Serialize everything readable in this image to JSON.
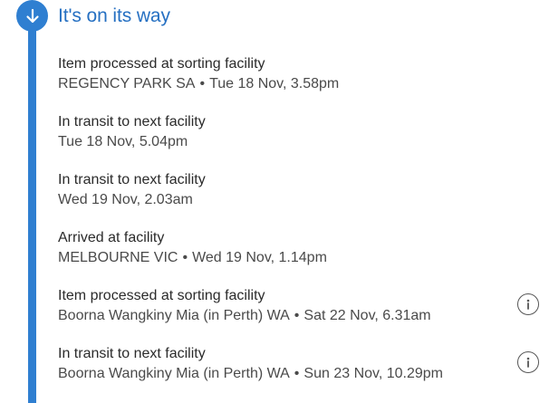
{
  "status": {
    "title": "It's on its way",
    "icon": "arrow-down-icon",
    "accent": "#2f7fd1"
  },
  "events": [
    {
      "title": "Item processed at sorting facility",
      "location": "REGENCY PARK SA",
      "time": "Tue 18 Nov, 3.58pm"
    },
    {
      "title": "In transit to next facility",
      "location": "",
      "time": "Tue 18 Nov, 5.04pm"
    },
    {
      "title": "In transit to next facility",
      "location": "",
      "time": "Wed 19 Nov, 2.03am"
    },
    {
      "title": "Arrived at facility",
      "location": "MELBOURNE VIC",
      "time": "Wed 19 Nov, 1.14pm"
    },
    {
      "title": "Item processed at sorting facility",
      "location": "Boorna Wangkiny Mia (in Perth) WA",
      "time": "Sat 22 Nov, 6.31am",
      "info_icon": "info-icon"
    },
    {
      "title": "In transit to next facility",
      "location": "Boorna Wangkiny Mia (in Perth) WA",
      "time": "Sun 23 Nov, 10.29pm",
      "info_icon": "info-icon"
    }
  ],
  "separator": "•"
}
